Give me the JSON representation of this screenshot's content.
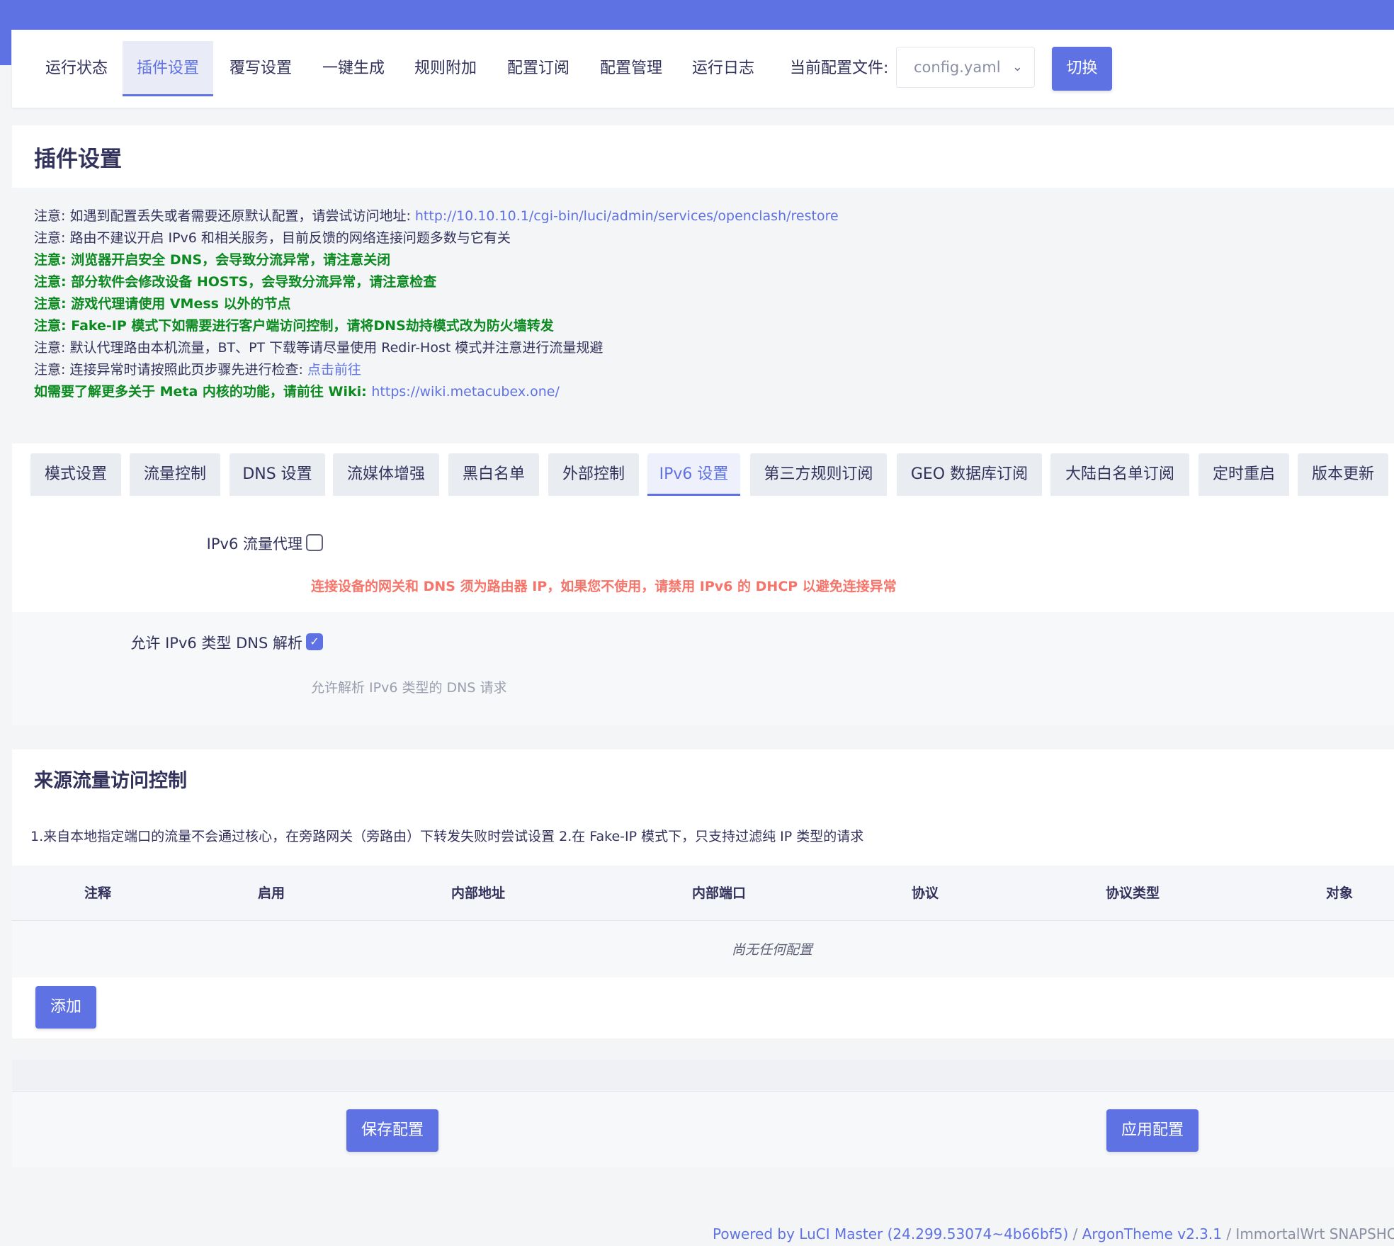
{
  "nav": {
    "tabs": [
      "运行状态",
      "插件设置",
      "覆写设置",
      "一键生成",
      "规则附加",
      "配置订阅",
      "配置管理",
      "运行日志"
    ],
    "active_index": 1,
    "config_label": "当前配置文件:",
    "config_value": "config.yaml",
    "switch_label": "切换"
  },
  "page": {
    "title": "插件设置"
  },
  "notes": {
    "n1_text": "注意: 如遇到配置丢失或者需要还原默认配置，请尝试访问地址: ",
    "n1_link": "http://10.10.10.1/cgi-bin/luci/admin/services/openclash/restore",
    "n2": "注意: 路由不建议开启 IPv6 和相关服务，目前反馈的网络连接问题多数与它有关",
    "n3": "注意: 浏览器开启安全 DNS，会导致分流异常，请注意关闭",
    "n4": "注意: 部分软件会修改设备 HOSTS，会导致分流异常，请注意检查",
    "n5": "注意: 游戏代理请使用 VMess 以外的节点",
    "n6": "注意: Fake-IP 模式下如需要进行客户端访问控制，请将DNS劫持模式改为防火墙转发",
    "n7": "注意: 默认代理路由本机流量，BT、PT 下载等请尽量使用 Redir-Host 模式并注意进行流量规避",
    "n8_text": "注意: 连接异常时请按照此页步骤先进行检查: ",
    "n8_link": "点击前往",
    "n9_text": "如需要了解更多关于 Meta 内核的功能，请前往 Wiki: ",
    "n9_link": "https://wiki.metacubex.one/"
  },
  "subtabs": {
    "items": [
      "模式设置",
      "流量控制",
      "DNS 设置",
      "流媒体增强",
      "黑白名单",
      "外部控制",
      "IPv6 设置",
      "第三方规则订阅",
      "GEO 数据库订阅",
      "大陆白名单订阅",
      "定时重启",
      "版本更新"
    ],
    "active_index": 6
  },
  "settings": {
    "ipv6_proxy_label": "IPv6 流量代理",
    "ipv6_proxy_checked": false,
    "ipv6_proxy_warning": "连接设备的网关和 DNS 须为路由器 IP，如果您不使用，请禁用 IPv6 的 DHCP 以避免连接异常",
    "ipv6_dns_label": "允许 IPv6 类型 DNS 解析",
    "ipv6_dns_checked": true,
    "ipv6_dns_hint": "允许解析 IPv6 类型的 DNS 请求"
  },
  "access_control": {
    "title": "来源流量访问控制",
    "description": "1.来自本地指定端口的流量不会通过核心，在旁路网关（旁路由）下转发失败时尝试设置 2.在 Fake-IP 模式下，只支持过滤纯 IP 类型的请求",
    "columns": [
      "注释",
      "启用",
      "内部地址",
      "内部端口",
      "协议",
      "协议类型",
      "对象"
    ],
    "empty_text": "尚无任何配置",
    "add_label": "添加"
  },
  "actions": {
    "save_label": "保存配置",
    "apply_label": "应用配置"
  },
  "footer": {
    "luci": "Powered by LuCI Master (24.299.53074~4b66bf5)",
    "sep1": " / ",
    "theme": "ArgonTheme v2.3.1",
    "sep2": " / ",
    "os": "ImmortalWrt SNAPSHOT"
  },
  "colors": {
    "accent": "#5e72e4",
    "note_green": "#0a8a1f",
    "warning_red": "#f5756a"
  }
}
